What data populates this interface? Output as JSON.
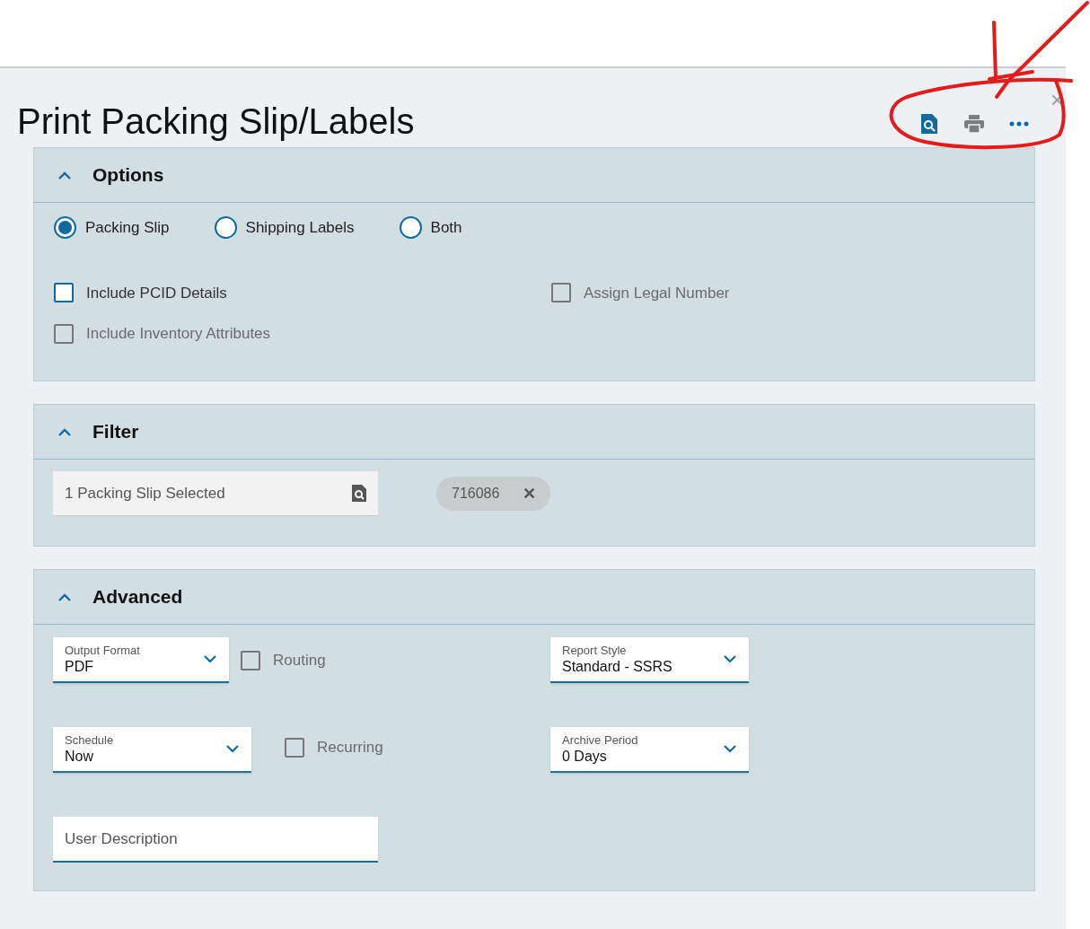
{
  "title": "Print Packing Slip/Labels",
  "close": "×",
  "options": {
    "title": "Options",
    "expanded": true,
    "radios": [
      {
        "label": "Packing Slip",
        "selected": true
      },
      {
        "label": "Shipping Labels",
        "selected": false
      },
      {
        "label": "Both",
        "selected": false
      }
    ],
    "checkboxes_left": [
      {
        "label": "Include PCID Details",
        "checked": false,
        "disabled": false
      },
      {
        "label": "Include Inventory Attributes",
        "checked": false,
        "disabled": true
      }
    ],
    "checkboxes_right": [
      {
        "label": "Assign Legal Number",
        "checked": false,
        "disabled": true
      }
    ]
  },
  "filter": {
    "title": "Filter",
    "expanded": true,
    "lookup": {
      "value": "1 Packing Slip Selected"
    },
    "tags": [
      {
        "label": "716086",
        "remove": "✕"
      }
    ]
  },
  "advanced": {
    "title": "Advanced",
    "expanded": true,
    "rows": [
      {
        "left": [
          {
            "kind": "dropdown",
            "label": "Output Format",
            "value": "PDF"
          },
          {
            "kind": "checkbox",
            "label": "Routing",
            "checked": false,
            "disabled": true
          }
        ],
        "right": [
          {
            "kind": "dropdown",
            "label": "Report Style",
            "value": "Standard - SSRS"
          }
        ]
      },
      {
        "left": [
          {
            "kind": "dropdown",
            "label": "Schedule",
            "value": "Now"
          },
          {
            "kind": "checkbox",
            "label": "Recurring",
            "checked": false,
            "disabled": true
          }
        ],
        "right": [
          {
            "kind": "dropdown",
            "label": "Archive Period",
            "value": "0 Days"
          }
        ]
      },
      {
        "left": [
          {
            "kind": "text",
            "placeholder": "User Description"
          }
        ],
        "right": []
      }
    ]
  }
}
